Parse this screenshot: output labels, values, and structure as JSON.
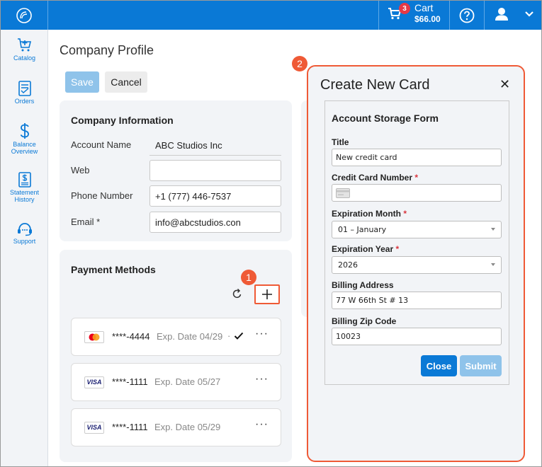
{
  "header": {
    "cart_label": "Cart",
    "cart_total": "$66.00",
    "cart_count": "3"
  },
  "sidebar": {
    "items": [
      {
        "label": "Catalog",
        "icon": "cart-plus-icon"
      },
      {
        "label": "Orders",
        "icon": "orders-icon"
      },
      {
        "label": "Balance Overview",
        "icon": "dollar-icon"
      },
      {
        "label": "Statement History",
        "icon": "statement-icon"
      },
      {
        "label": "Support",
        "icon": "headset-icon"
      }
    ]
  },
  "page": {
    "title": "Company Profile",
    "save_label": "Save",
    "cancel_label": "Cancel"
  },
  "company_info": {
    "title": "Company Information",
    "account_name_label": "Account Name",
    "account_name_value": "ABC Studios Inc",
    "web_label": "Web",
    "web_value": "",
    "phone_label": "Phone Number",
    "phone_value": "+1 (777) 446-7537",
    "email_label": "Email *",
    "email_value": "info@abcstudios.con"
  },
  "payment_methods": {
    "title": "Payment Methods",
    "cards": [
      {
        "brand": "mastercard",
        "number": "****-4444",
        "exp": "Exp. Date 04/29",
        "default": true
      },
      {
        "brand": "VISA",
        "number": "****-1111",
        "exp": "Exp. Date 05/27",
        "default": false
      },
      {
        "brand": "VISA",
        "number": "****-1111",
        "exp": "Exp. Date 05/29",
        "default": false
      }
    ]
  },
  "callouts": {
    "one": "1",
    "two": "2"
  },
  "modal": {
    "title": "Create New Card",
    "form_heading": "Account Storage Form",
    "title_label": "Title",
    "title_value": "New credit card",
    "cc_label": "Credit Card Number",
    "exp_month_label": "Expiration Month",
    "exp_month_value": "01 – January",
    "exp_year_label": "Expiration Year",
    "exp_year_value": "2026",
    "billing_label": "Billing Address",
    "billing_value": "77 W 66th St # 13",
    "zip_label": "Billing Zip Code",
    "zip_value": "10023",
    "required_mark": "*",
    "close_label": "Close",
    "submit_label": "Submit"
  },
  "colors": {
    "brand_blue": "#0a79d6",
    "callout_orange": "#ef5a36"
  }
}
